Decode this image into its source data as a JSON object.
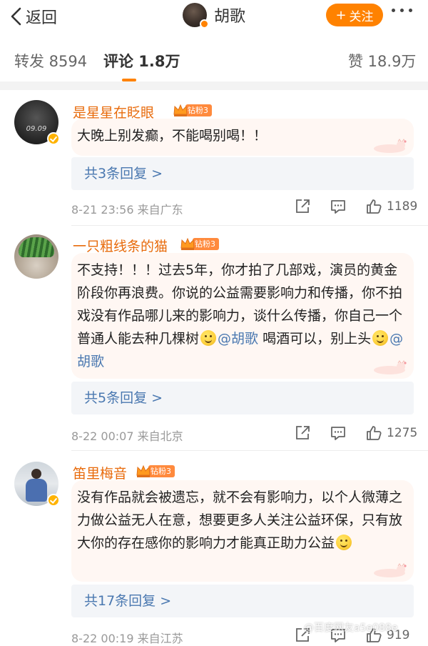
{
  "header": {
    "back_label": "返回",
    "user_name": "胡歌",
    "follow_label": "关注",
    "follow_plus": "+"
  },
  "tabs": {
    "repost": "转发 8594",
    "comment": "评论 1.8万",
    "like": "赞 18.9万"
  },
  "comments": [
    {
      "username": "是星星在眨眼_",
      "fan_badge": "钻粉3",
      "text": "大晚上别发癫，不能喝别喝！！",
      "replies": "共3条回复 >",
      "time_source": "8-21 23:56  来自广东",
      "likes": "1189",
      "avatar_text": "09.09"
    },
    {
      "username": "一只粗线条的猫",
      "fan_badge": "钻粉3",
      "text_parts": [
        "不支持！！！过去5年，你才拍了几部戏，演员的黄金阶段你再浪费。你说的公益需要影响力和传播，你不拍戏没有作品哪儿来的影响力，谈什么传播，你自己一个普通人能去种几棵树",
        "@胡歌",
        " 喝酒可以，别上头",
        "@胡歌"
      ],
      "replies": "共5条回复 >",
      "time_source": "8-22 00:07  来自北京",
      "likes": "1275"
    },
    {
      "username": "笛里梅音",
      "fan_badge": "钻粉3",
      "text": "没有作品就会被遗忘，就不会有影响力，以个人微薄之力做公益无人在意，想要更多人关注公益环保，只有放大你的存在感你的影响力才能真正助力公益",
      "replies": "共17条回复 >",
      "time_source": "8-22 00:19  来自江苏",
      "likes": "919"
    }
  ],
  "watermark": "@百度网友a5e088e",
  "colors": {
    "accent": "#ff8200",
    "username": "#e86b0c",
    "link": "#4a78b0",
    "bubble": "#fff7f3"
  },
  "icons": [
    "chevron-left-icon",
    "share-icon",
    "comment-icon",
    "thumb-up-icon",
    "smiley-emoji-icon",
    "crown-icon",
    "verified-badge-icon"
  ]
}
